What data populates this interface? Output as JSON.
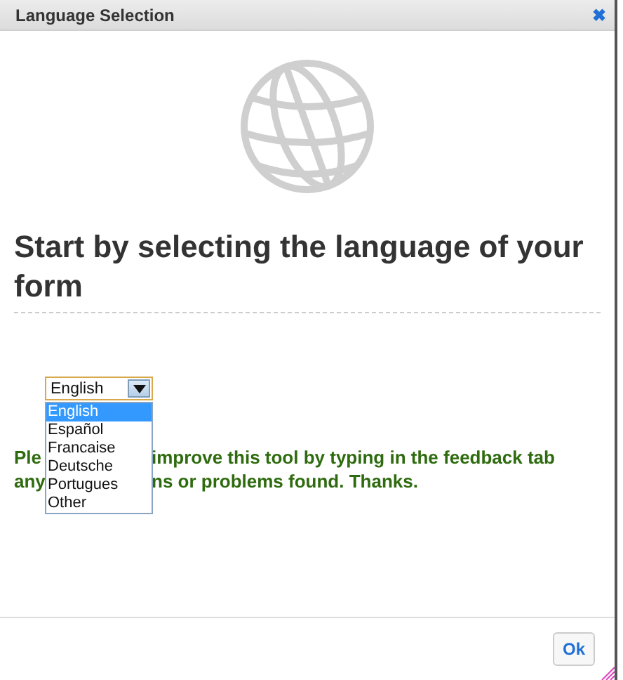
{
  "window": {
    "title": "Language Selection",
    "close": "✖"
  },
  "heading": "Start by selecting the language of your form",
  "language_select": {
    "value": "English",
    "expanded": true,
    "options": [
      {
        "label": "English",
        "selected": true
      },
      {
        "label": "Español",
        "selected": false
      },
      {
        "label": "Francaise",
        "selected": false
      },
      {
        "label": "Deutsche",
        "selected": false
      },
      {
        "label": "Portugues",
        "selected": false
      },
      {
        "label": "Other",
        "selected": false
      }
    ]
  },
  "message_lines": [
    {
      "visible_start": "Ple",
      "visible_end": "improve this tool by typing in the feedback tab"
    },
    {
      "visible_start": "any",
      "visible_end": "ns or problems found. Thanks."
    }
  ],
  "buttons": [
    {
      "label": "Ok"
    }
  ]
}
